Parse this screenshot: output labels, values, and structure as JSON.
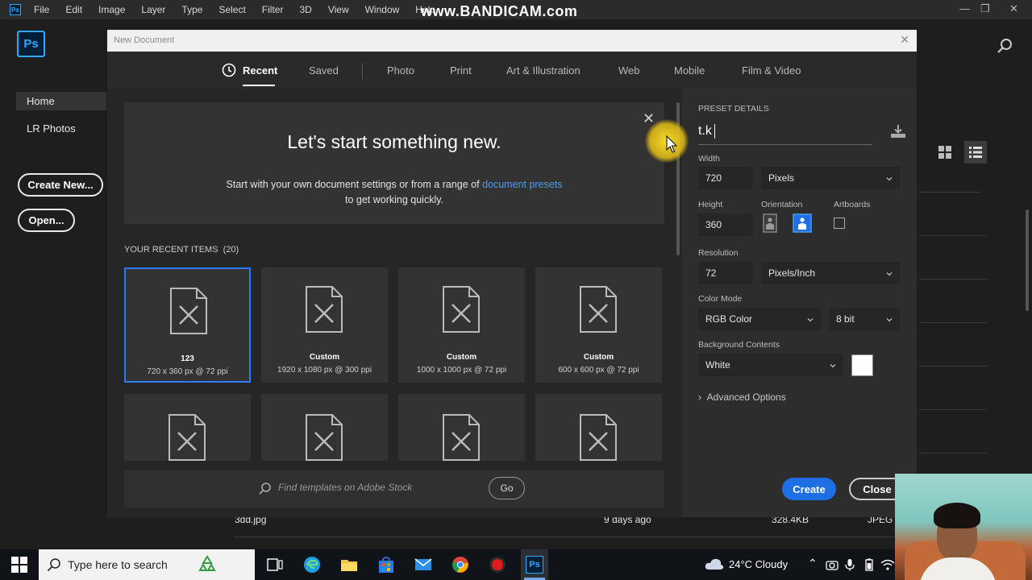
{
  "menu": {
    "items": [
      "File",
      "Edit",
      "Image",
      "Layer",
      "Type",
      "Select",
      "Filter",
      "3D",
      "View",
      "Window",
      "Help"
    ]
  },
  "watermark": "www.BANDICAM.com",
  "app": {
    "logo": "Ps"
  },
  "home_nav": {
    "home": "Home",
    "lr_photos": "LR Photos",
    "create_new": "Create New...",
    "open": "Open..."
  },
  "dialog": {
    "title": "New Document",
    "tabs": [
      "Recent",
      "Saved",
      "Photo",
      "Print",
      "Art & Illustration",
      "Web",
      "Mobile",
      "Film & Video"
    ],
    "active_tab": "Recent",
    "hero": {
      "title": "Let's start something new.",
      "line1_pre": "Start with your own document settings or from a range of",
      "line1_link": "document presets",
      "line2": "to get working quickly."
    },
    "recent_header": "YOUR RECENT ITEMS",
    "recent_count": "(20)",
    "recent_items": [
      {
        "name": "123",
        "dims": "720 x 360 px @ 72 ppi",
        "selected": true
      },
      {
        "name": "Custom",
        "dims": "1920 x 1080 px @ 300 ppi",
        "selected": false
      },
      {
        "name": "Custom",
        "dims": "1000 x 1000 px @ 72 ppi",
        "selected": false
      },
      {
        "name": "Custom",
        "dims": "600 x 600 px @ 72 ppi",
        "selected": false
      }
    ],
    "stock_search_placeholder": "Find templates on Adobe Stock",
    "go_label": "Go",
    "preset": {
      "header": "PRESET DETAILS",
      "name": "t.k",
      "width_label": "Width",
      "width_value": "720",
      "width_unit": "Pixels",
      "height_label": "Height",
      "height_value": "360",
      "orientation_label": "Orientation",
      "artboards_label": "Artboards",
      "resolution_label": "Resolution",
      "resolution_value": "72",
      "resolution_unit": "Pixels/Inch",
      "color_mode_label": "Color Mode",
      "color_mode": "RGB Color",
      "bit_depth": "8 bit",
      "bg_label": "Background Contents",
      "bg_value": "White",
      "advanced": "Advanced Options"
    },
    "create_label": "Create",
    "close_label": "Close"
  },
  "background_file": {
    "name": "3dd.jpg",
    "modified": "9 days ago",
    "size": "328.4KB",
    "type": "JPEG"
  },
  "taskbar": {
    "search_placeholder": "Type here to search",
    "weather": "24°C  Cloudy"
  },
  "colors": {
    "accent": "#1e6fe4",
    "ps_blue": "#31a8ff",
    "link": "#4d9cf0"
  }
}
